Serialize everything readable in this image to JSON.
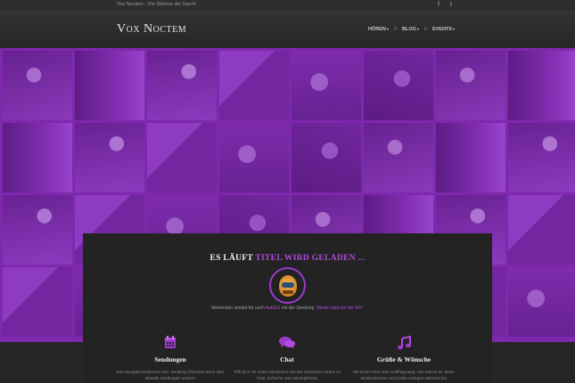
{
  "topbar": {
    "tagline": "Vox Noctem - Die Stimme der Nacht",
    "social": [
      {
        "icon": "facebook-icon",
        "glyph": "f"
      },
      {
        "icon": "twitter-icon",
        "glyph": "t"
      }
    ]
  },
  "header": {
    "logo": "Vox Noctem",
    "nav": [
      {
        "label": "HÖREN"
      },
      {
        "label": "BLOG"
      },
      {
        "label": "EVENTS"
      }
    ],
    "nav_separator": "//"
  },
  "colors": {
    "accent": "#b24ae0",
    "hero_purple": "#7a24a8",
    "panel": "#232323",
    "background": "#262626"
  },
  "onair": {
    "prefix": "ES LÄUFT",
    "title": "TITEL WIRD GELADEN ..."
  },
  "nowplaying": {
    "text_1": "Momentan sendet für euch",
    "dj": "AutoDJ",
    "text_2": "mit der Sendung",
    "show": "\"Musik rund um die Uhr\""
  },
  "features": [
    {
      "icon": "calendar-icon",
      "title": "Sendungen",
      "text": "Das Navigationselement Live- Sendung informiert Euch über aktuelle Sendungen unserer"
    },
    {
      "icon": "chat-bubble-icon",
      "title": "Chat",
      "text": "Trifft dich mit netten Menschen aus der schwarzen Szene im Chat. Einfache und unkomplizierte"
    },
    {
      "icon": "music-note-icon",
      "title": "Grüße & Wünsche",
      "text": "Mit einem Klick zum Liedfragmang. Hier kannst Dr. deine Musikwünsche und Grüße einlegen während der"
    }
  ]
}
